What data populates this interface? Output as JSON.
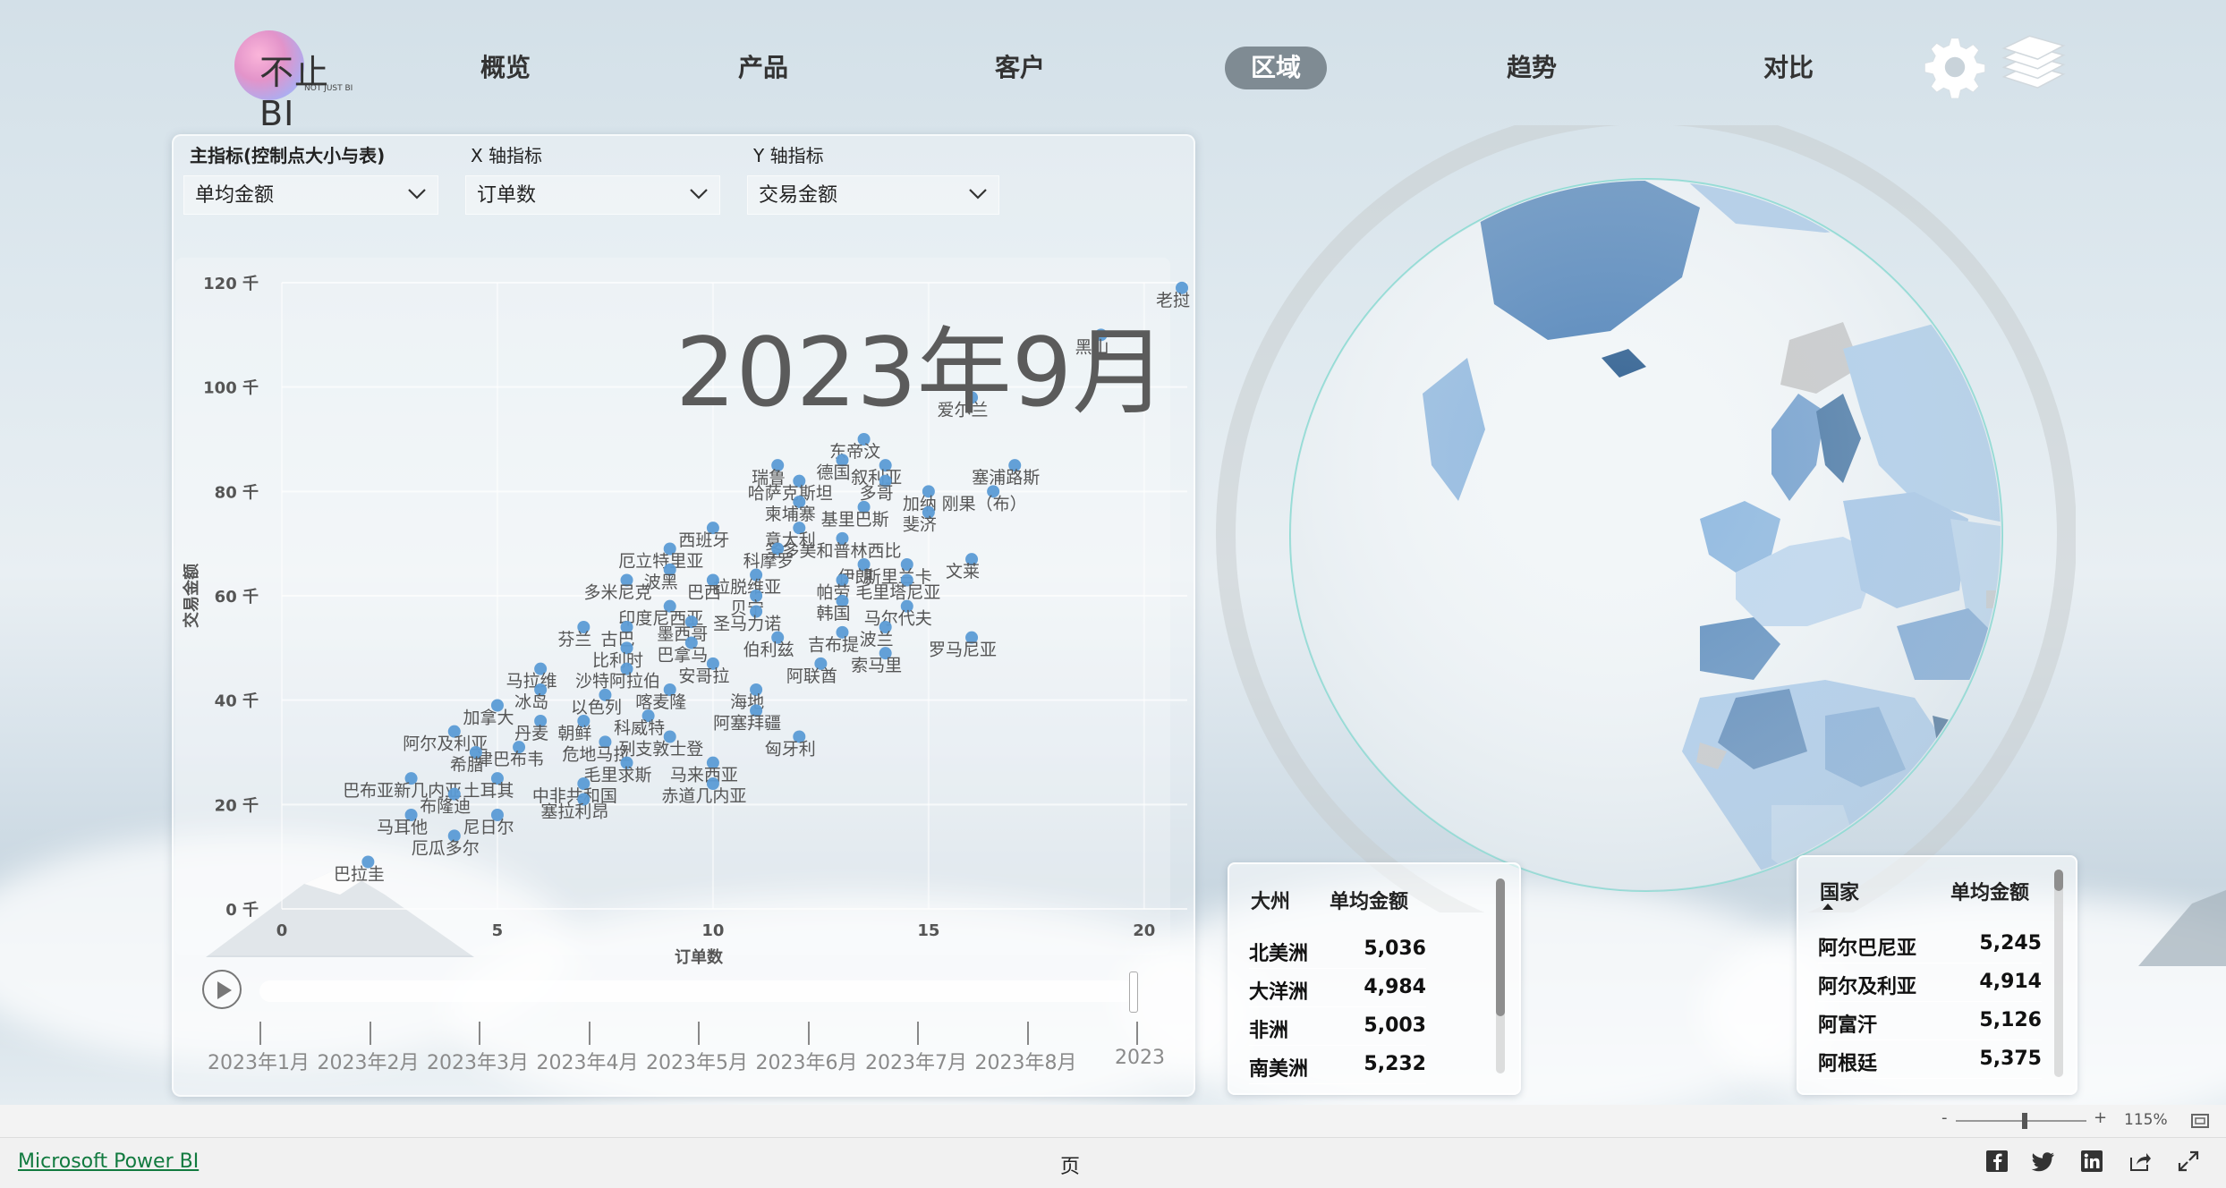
{
  "nav": {
    "logo_text": "不止BI",
    "logo_sub": "NOT JUST BI",
    "items": [
      {
        "label": "概览"
      },
      {
        "label": "产品"
      },
      {
        "label": "客户"
      },
      {
        "label": "区域",
        "active": true
      },
      {
        "label": "趋势"
      },
      {
        "label": "对比"
      }
    ],
    "settings_icon": "gear-icon",
    "layers_icon": "layers-icon"
  },
  "filters": {
    "main_metric": {
      "label": "主指标(控制点大小与表)",
      "value": "单均金额"
    },
    "x_metric": {
      "label": "X 轴指标",
      "value": "订单数"
    },
    "y_metric": {
      "label": "Y 轴指标",
      "value": "交易金额"
    }
  },
  "chart_data": {
    "type": "scatter",
    "title": "",
    "xlabel": "订单数",
    "ylabel": "交易金额",
    "xlim": [
      0,
      21
    ],
    "ylim": [
      0,
      120
    ],
    "xticks": [
      "0",
      "5",
      "10",
      "15",
      "20"
    ],
    "yticks": [
      "0 千",
      "20 千",
      "40 千",
      "60 千",
      "80 千",
      "100 千",
      "120 千"
    ],
    "play_label": "2023年9月",
    "series_color": "#5b9bd5",
    "points": [
      {
        "label": "老挝",
        "x": 21.5,
        "y": 119
      },
      {
        "label": "黑山",
        "x": 19,
        "y": 110
      },
      {
        "label": "爱尔兰",
        "x": 16,
        "y": 98
      },
      {
        "label": "东帝汶",
        "x": 13.5,
        "y": 90
      },
      {
        "label": "德国",
        "x": 13,
        "y": 86
      },
      {
        "label": "瑞鲁",
        "x": 11.5,
        "y": 85
      },
      {
        "label": "叙利亚",
        "x": 14,
        "y": 85
      },
      {
        "label": "塞浦路斯",
        "x": 17,
        "y": 85
      },
      {
        "label": "哈萨克斯坦",
        "x": 12,
        "y": 82
      },
      {
        "label": "多哥",
        "x": 14,
        "y": 82
      },
      {
        "label": "加纳",
        "x": 15,
        "y": 80
      },
      {
        "label": "刚果（布）",
        "x": 16.5,
        "y": 80
      },
      {
        "label": "柬埔寨",
        "x": 12,
        "y": 78
      },
      {
        "label": "基里巴斯",
        "x": 13.5,
        "y": 77
      },
      {
        "label": "斐济",
        "x": 15,
        "y": 76
      },
      {
        "label": "西班牙",
        "x": 10,
        "y": 73
      },
      {
        "label": "意大利",
        "x": 12,
        "y": 73
      },
      {
        "label": "圣多美和普林西比",
        "x": 13,
        "y": 71
      },
      {
        "label": "厄立特里亚",
        "x": 9,
        "y": 69
      },
      {
        "label": "科摩罗",
        "x": 11.5,
        "y": 69
      },
      {
        "label": "文莱",
        "x": 16,
        "y": 67
      },
      {
        "label": "伊朗",
        "x": 13.5,
        "y": 66
      },
      {
        "label": "斯里兰卡",
        "x": 14.5,
        "y": 66
      },
      {
        "label": "波黑",
        "x": 9,
        "y": 65
      },
      {
        "label": "拉脱维亚",
        "x": 11,
        "y": 64
      },
      {
        "label": "多米尼克",
        "x": 8,
        "y": 63
      },
      {
        "label": "巴西",
        "x": 10,
        "y": 63
      },
      {
        "label": "帕劳",
        "x": 13,
        "y": 63
      },
      {
        "label": "毛里塔尼亚",
        "x": 14.5,
        "y": 63
      },
      {
        "label": "贝宁",
        "x": 11,
        "y": 60
      },
      {
        "label": "韩国",
        "x": 13,
        "y": 59
      },
      {
        "label": "马尔代夫",
        "x": 14.5,
        "y": 58
      },
      {
        "label": "印度尼西亚",
        "x": 9,
        "y": 58
      },
      {
        "label": "圣马力诺",
        "x": 11,
        "y": 57
      },
      {
        "label": "墨西哥",
        "x": 9.5,
        "y": 55
      },
      {
        "label": "芬兰",
        "x": 7,
        "y": 54
      },
      {
        "label": "古巴",
        "x": 8,
        "y": 54
      },
      {
        "label": "吉布提",
        "x": 13,
        "y": 53
      },
      {
        "label": "波兰",
        "x": 14,
        "y": 54
      },
      {
        "label": "伯利兹",
        "x": 11.5,
        "y": 52
      },
      {
        "label": "罗马尼亚",
        "x": 16,
        "y": 52
      },
      {
        "label": "巴拿马",
        "x": 9.5,
        "y": 51
      },
      {
        "label": "比利时",
        "x": 8,
        "y": 50
      },
      {
        "label": "索马里",
        "x": 14,
        "y": 49
      },
      {
        "label": "安哥拉",
        "x": 10,
        "y": 47
      },
      {
        "label": "阿联酋",
        "x": 12.5,
        "y": 47
      },
      {
        "label": "马拉维",
        "x": 6,
        "y": 46
      },
      {
        "label": "沙特阿拉伯",
        "x": 8,
        "y": 46
      },
      {
        "label": "冰岛",
        "x": 6,
        "y": 42
      },
      {
        "label": "喀麦隆",
        "x": 9,
        "y": 42
      },
      {
        "label": "海地",
        "x": 11,
        "y": 42
      },
      {
        "label": "以色列",
        "x": 7.5,
        "y": 41
      },
      {
        "label": "加拿大",
        "x": 5,
        "y": 39
      },
      {
        "label": "阿塞拜疆",
        "x": 11,
        "y": 38
      },
      {
        "label": "科威特",
        "x": 8.5,
        "y": 37
      },
      {
        "label": "丹麦",
        "x": 6,
        "y": 36
      },
      {
        "label": "朝鲜",
        "x": 7,
        "y": 36
      },
      {
        "label": "阿尔及利亚",
        "x": 4,
        "y": 34
      },
      {
        "label": "列支敦士登",
        "x": 9,
        "y": 33
      },
      {
        "label": "匈牙利",
        "x": 12,
        "y": 33
      },
      {
        "label": "津巴布韦",
        "x": 5.5,
        "y": 31
      },
      {
        "label": "危地马拉",
        "x": 7.5,
        "y": 32
      },
      {
        "label": "希腊",
        "x": 4.5,
        "y": 30
      },
      {
        "label": "毛里求斯",
        "x": 8,
        "y": 28
      },
      {
        "label": "马来西亚",
        "x": 10,
        "y": 28
      },
      {
        "label": "巴布亚新几内亚",
        "x": 3,
        "y": 25
      },
      {
        "label": "土耳其",
        "x": 5,
        "y": 25
      },
      {
        "label": "中非共和国",
        "x": 7,
        "y": 24
      },
      {
        "label": "赤道几内亚",
        "x": 10,
        "y": 24
      },
      {
        "label": "布隆迪",
        "x": 4,
        "y": 22
      },
      {
        "label": "塞拉利昂",
        "x": 7,
        "y": 21
      },
      {
        "label": "马耳他",
        "x": 3,
        "y": 18
      },
      {
        "label": "尼日尔",
        "x": 5,
        "y": 18
      },
      {
        "label": "厄瓜多尔",
        "x": 4,
        "y": 14
      },
      {
        "label": "巴拉圭",
        "x": 2,
        "y": 9
      }
    ]
  },
  "play_axis": {
    "months": [
      "2023年1月",
      "2023年2月",
      "2023年3月",
      "2023年4月",
      "2023年5月",
      "2023年6月",
      "2023年7月",
      "2023年8月",
      "2023年9月"
    ],
    "current": "2023年9月"
  },
  "continent_table": {
    "headers": [
      "大州",
      "单均金额"
    ],
    "rows": [
      {
        "name": "北美洲",
        "value": "5,036"
      },
      {
        "name": "大洋洲",
        "value": "4,984"
      },
      {
        "name": "非洲",
        "value": "5,003"
      },
      {
        "name": "南美洲",
        "value": "5,232"
      }
    ]
  },
  "country_table": {
    "headers": [
      "国家",
      "单均金额"
    ],
    "rows": [
      {
        "name": "阿尔巴尼亚",
        "value": "5,245"
      },
      {
        "name": "阿尔及利亚",
        "value": "4,914"
      },
      {
        "name": "阿富汗",
        "value": "5,126"
      },
      {
        "name": "阿根廷",
        "value": "5,375"
      }
    ]
  },
  "zoom": {
    "minus": "-",
    "plus": "+",
    "level": "115%"
  },
  "status": {
    "app_link": "Microsoft Power BI",
    "page_label": "页"
  }
}
